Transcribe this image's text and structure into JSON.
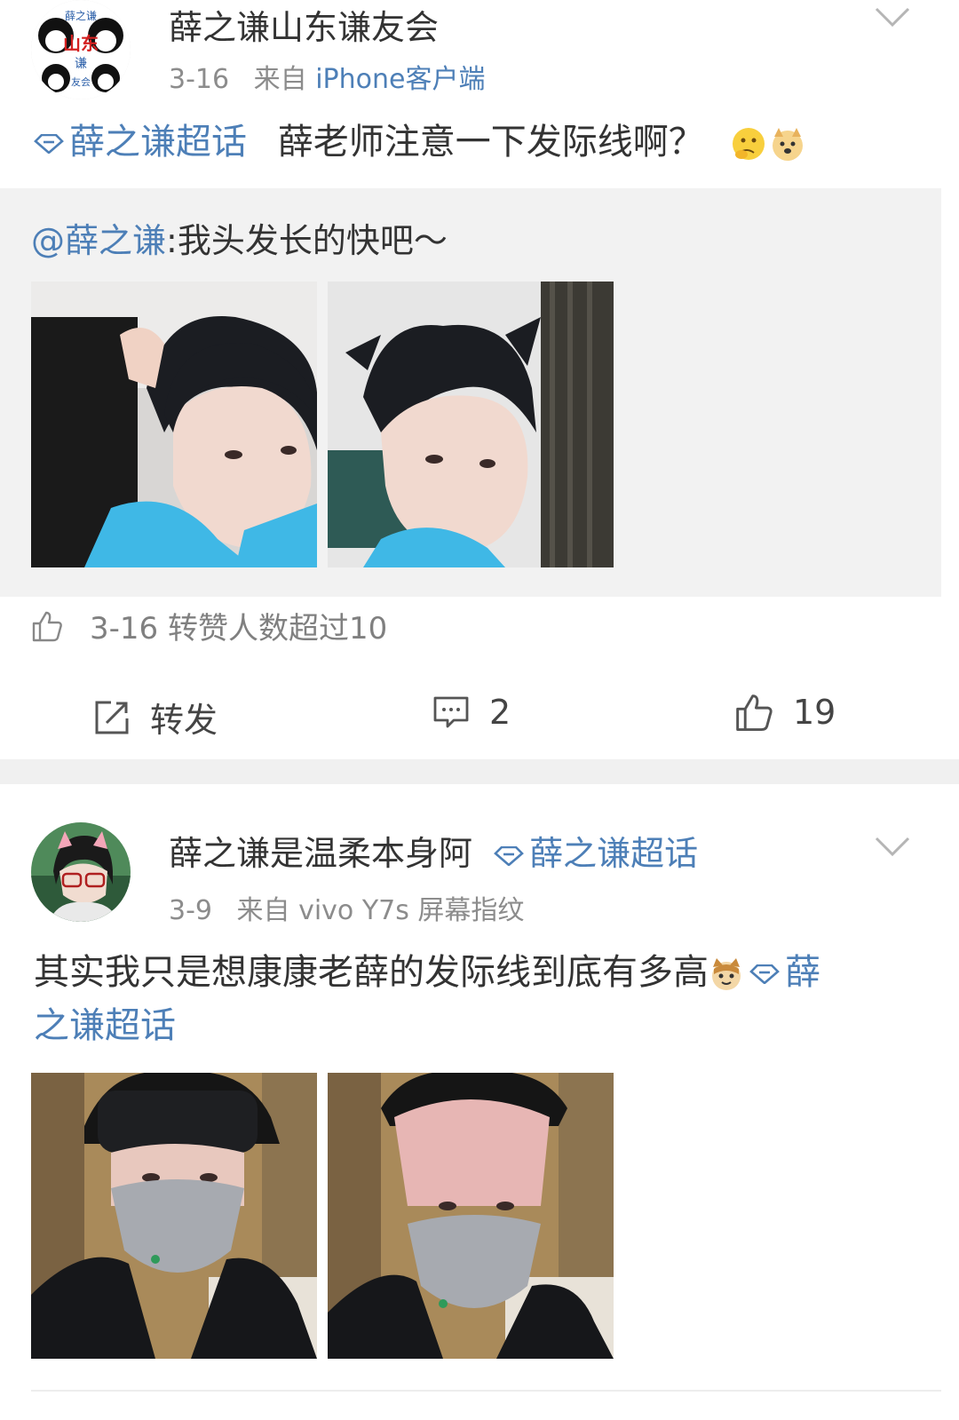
{
  "post1": {
    "username": "薛之谦山东谦友会",
    "avatar_text": [
      "薛之谦",
      "山东",
      "谦",
      "友会"
    ],
    "time": "3-16",
    "from_prefix": "来自",
    "source": "iPhone客户端",
    "topic": "薛之谦超话",
    "text": "薛老师注意一下发际线啊？",
    "emojis": [
      "thinking-emoji",
      "doge-emoji"
    ],
    "quoted": {
      "mention": "@薛之谦",
      "text": ":我头发长的快吧～"
    },
    "like_row": "3-16 转赞人数超过10",
    "actions": {
      "repost_label": "转发",
      "comment_count": "2",
      "like_count": "19"
    }
  },
  "post2": {
    "username": "薛之谦是温柔本身阿",
    "topic_badge": "薛之谦超话",
    "time": "3-9",
    "from_prefix": "来自",
    "source": "vivo Y7s 屏幕指纹",
    "text": "其实我只是想康康老薛的发际线到底有多高",
    "topic_part1": "薛",
    "topic_part2": "之谦超话"
  },
  "colors": {
    "link": "#4d7fb7",
    "divider": "#f0f0f0",
    "quoted_bg": "#f2f2f2",
    "hoodie": "#3fb8e6"
  }
}
